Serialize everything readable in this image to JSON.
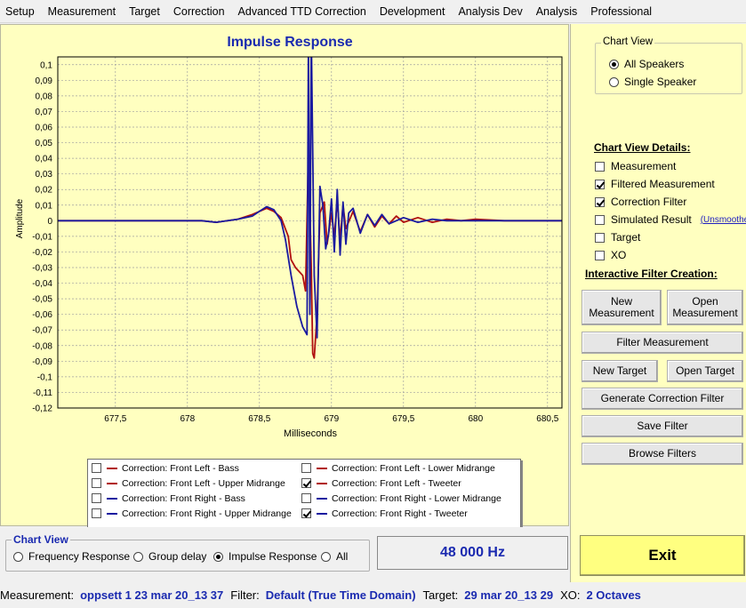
{
  "menu": [
    "Setup",
    "Measurement",
    "Target",
    "Correction",
    "Advanced TTD Correction",
    "Development",
    "Analysis Dev",
    "Analysis",
    "Professional"
  ],
  "chart_data": {
    "type": "line",
    "title": "Impulse Response",
    "xlabel": "Milliseconds",
    "ylabel": "Amplitude",
    "xlim": [
      677.1,
      680.6
    ],
    "ylim": [
      -0.12,
      0.105
    ],
    "xticks": [
      "677,5",
      "678",
      "678,5",
      "679",
      "679,5",
      "680",
      "680,5"
    ],
    "xtick_values": [
      677.5,
      678,
      678.5,
      679,
      679.5,
      680,
      680.5
    ],
    "yticks": [
      "0,1",
      "0,09",
      "0,08",
      "0,07",
      "0,06",
      "0,05",
      "0,04",
      "0,03",
      "0,02",
      "0,01",
      "0",
      "-0,01",
      "-0,02",
      "-0,03",
      "-0,04",
      "-0,05",
      "-0,06",
      "-0,07",
      "-0,08",
      "-0,09",
      "-0,1",
      "-0,11",
      "-0,12"
    ],
    "ytick_values": [
      0.1,
      0.09,
      0.08,
      0.07,
      0.06,
      0.05,
      0.04,
      0.03,
      0.02,
      0.01,
      0,
      -0.01,
      -0.02,
      -0.03,
      -0.04,
      -0.05,
      -0.06,
      -0.07,
      -0.08,
      -0.09,
      -0.1,
      -0.11,
      -0.12
    ],
    "grid": true,
    "series": [
      {
        "name": "Correction: Front Left - Tweeter",
        "color": "#b01010",
        "x": [
          677.1,
          678.1,
          678.2,
          678.35,
          678.45,
          678.5,
          678.55,
          678.6,
          678.65,
          678.7,
          678.72,
          678.75,
          678.8,
          678.82,
          678.84,
          678.86,
          678.87,
          678.88,
          678.9,
          678.92,
          678.95,
          678.97,
          679.0,
          679.02,
          679.04,
          679.06,
          679.08,
          679.1,
          679.15,
          679.2,
          679.25,
          679.3,
          679.35,
          679.4,
          679.45,
          679.5,
          679.6,
          679.7,
          679.8,
          679.9,
          680.0,
          680.2,
          680.4,
          680.6
        ],
        "y": [
          0,
          0,
          -0.001,
          0.001,
          0.004,
          0.006,
          0.008,
          0.006,
          0.002,
          -0.01,
          -0.025,
          -0.03,
          -0.035,
          -0.045,
          0.045,
          -0.03,
          -0.085,
          -0.088,
          -0.06,
          0.005,
          0.012,
          -0.015,
          0.005,
          -0.01,
          0.013,
          -0.012,
          0.01,
          -0.005,
          0.006,
          -0.007,
          0.004,
          -0.004,
          0.003,
          -0.002,
          0.003,
          -0.001,
          0.002,
          -0.001,
          0.001,
          0,
          0.001,
          0,
          0,
          0
        ]
      },
      {
        "name": "Correction: Front Right - Tweeter",
        "color": "#1a1aa0",
        "x": [
          677.1,
          678.1,
          678.2,
          678.35,
          678.45,
          678.5,
          678.55,
          678.6,
          678.65,
          678.68,
          678.72,
          678.76,
          678.8,
          678.83,
          678.84,
          678.85,
          678.86,
          678.88,
          678.9,
          678.92,
          678.94,
          678.96,
          678.98,
          679.0,
          679.02,
          679.04,
          679.06,
          679.08,
          679.1,
          679.12,
          679.15,
          679.2,
          679.25,
          679.3,
          679.35,
          679.4,
          679.5,
          679.6,
          679.7,
          679.8,
          680.0,
          680.3,
          680.6
        ],
        "y": [
          0,
          0,
          -0.001,
          0.001,
          0.003,
          0.006,
          0.009,
          0.007,
          0.0,
          -0.012,
          -0.035,
          -0.055,
          -0.068,
          -0.073,
          0.12,
          -0.06,
          0.12,
          -0.035,
          -0.075,
          0.022,
          0.01,
          -0.018,
          -0.008,
          0.014,
          -0.02,
          0.02,
          -0.022,
          0.012,
          -0.015,
          0.005,
          0.008,
          -0.008,
          0.004,
          -0.003,
          0.004,
          -0.002,
          0.002,
          -0.001,
          0.001,
          0,
          0,
          0,
          0
        ]
      }
    ]
  },
  "legend": [
    {
      "label": "Correction: Front Left - Bass",
      "color": "#b01010",
      "checked": false
    },
    {
      "label": "Correction: Front Left - Lower Midrange",
      "color": "#b01010",
      "checked": false
    },
    {
      "label": "Correction: Front Left - Upper Midrange",
      "color": "#b01010",
      "checked": false
    },
    {
      "label": "Correction: Front Left - Tweeter",
      "color": "#b01010",
      "checked": true
    },
    {
      "label": "Correction: Front Right - Bass",
      "color": "#1a1aa0",
      "checked": false
    },
    {
      "label": "Correction: Front Right - Lower Midrange",
      "color": "#1a1aa0",
      "checked": false
    },
    {
      "label": "Correction: Front Right - Upper Midrange",
      "color": "#1a1aa0",
      "checked": false
    },
    {
      "label": "Correction: Front Right - Tweeter",
      "color": "#1a1aa0",
      "checked": true
    }
  ],
  "chart_view": {
    "title": "Chart View",
    "all_speakers": "All Speakers",
    "single_speaker": "Single Speaker",
    "selected": "All Speakers"
  },
  "details": {
    "heading": "Chart View Details:",
    "measurement": "Measurement",
    "filtered_measurement": "Filtered Measurement",
    "correction_filter": "Correction Filter",
    "simulated_result": "Simulated Result",
    "unsmoothed": "(Unsmoothed)",
    "target": "Target",
    "xo": "XO"
  },
  "interactive": {
    "heading": "Interactive Filter Creation:",
    "new_measurement": "New Measurement",
    "open_measurement": "Open Measurement",
    "filter_measurement": "Filter Measurement",
    "new_target": "New Target",
    "open_target": "Open Target",
    "generate_correction_filter": "Generate Correction Filter",
    "save_filter": "Save Filter",
    "browse_filters": "Browse Filters"
  },
  "bottom": {
    "chart_view_title": "Chart View",
    "frequency_response": "Frequency Response",
    "group_delay": "Group delay",
    "impulse_response": "Impulse Response",
    "all": "All",
    "selected": "Impulse Response",
    "sample_rate": "48 000 Hz",
    "exit": "Exit"
  },
  "status": {
    "measurement_label": "Measurement:",
    "measurement_value": "oppsett 1 23 mar 20_13 37",
    "filter_label": "Filter:",
    "filter_value": "Default (True Time Domain)",
    "target_label": "Target:",
    "target_value": "29 mar 20_13 29",
    "xo_label": "XO:",
    "xo_value": "2 Octaves"
  }
}
